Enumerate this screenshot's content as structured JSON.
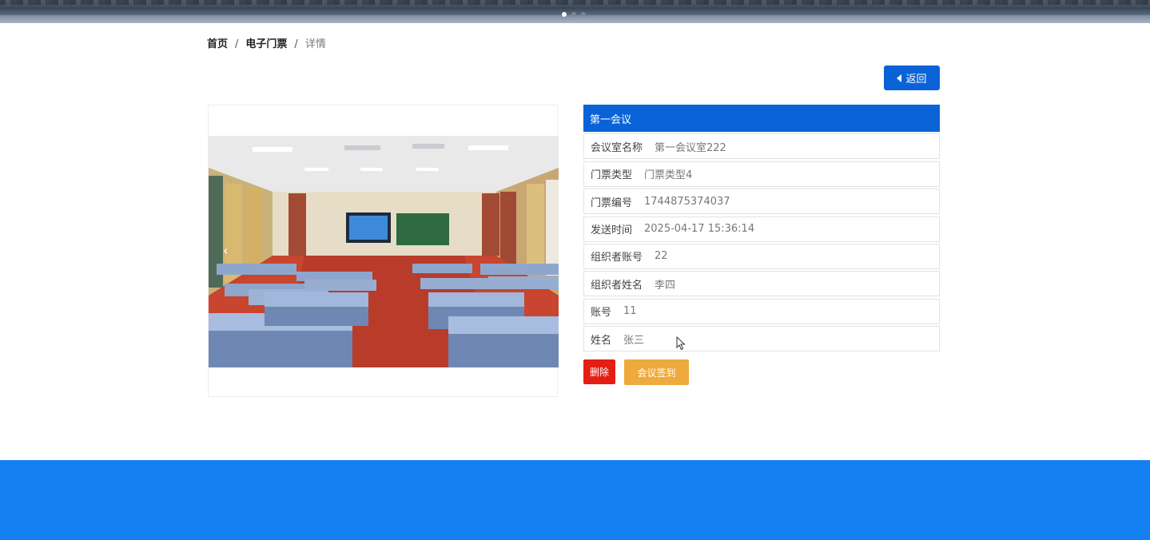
{
  "banner": {
    "slide_count": 3,
    "active_slide": 1
  },
  "breadcrumb": {
    "home": "首页",
    "separator": "/",
    "section": "电子门票",
    "current": "详情"
  },
  "back_button": {
    "label": "返回",
    "icon": "caret-left-icon"
  },
  "carousel": {
    "prev_icon": "‹"
  },
  "detail": {
    "title": "第一会议",
    "rows": [
      {
        "label": "会议室名称",
        "value": "第一会议室222"
      },
      {
        "label": "门票类型",
        "value": "门票类型4"
      },
      {
        "label": "门票编号",
        "value": "1744875374037"
      },
      {
        "label": "发送时间",
        "value": "2025-04-17 15:36:14"
      },
      {
        "label": "组织者账号",
        "value": "22"
      },
      {
        "label": "组织者姓名",
        "value": "李四"
      },
      {
        "label": "账号",
        "value": "11"
      },
      {
        "label": "姓名",
        "value": "张三"
      }
    ]
  },
  "actions": {
    "delete": "删除",
    "sign_in": "会议签到"
  },
  "colors": {
    "primary": "#0a63d6",
    "delete": "#e41e13",
    "sign_in": "#eeaa3c",
    "footer": "#1580f2"
  }
}
